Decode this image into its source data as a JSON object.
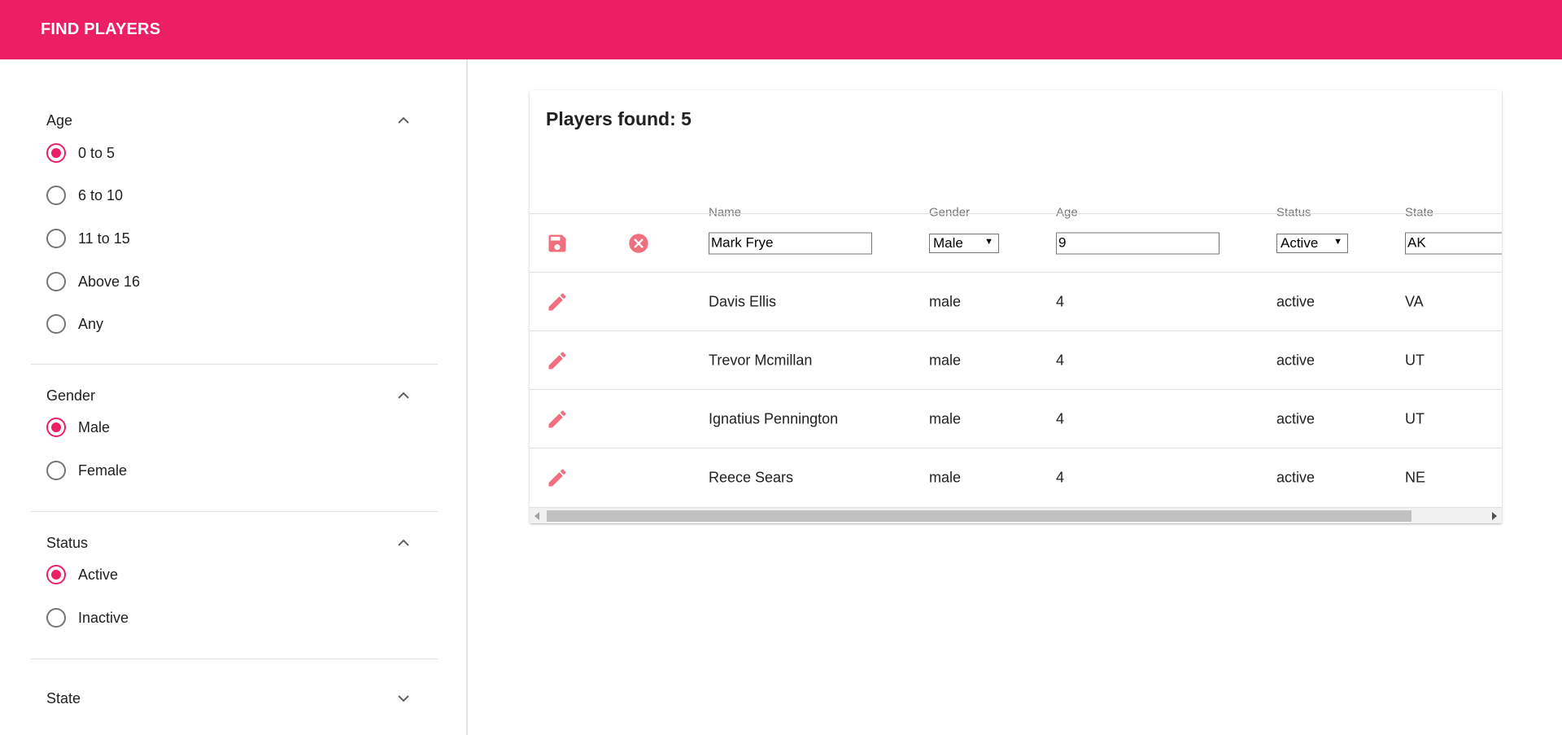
{
  "app": {
    "title": "FIND PLAYERS",
    "accent": "#ec1f65"
  },
  "filters": {
    "age": {
      "label": "Age",
      "expanded": true,
      "options": [
        "0 to 5",
        "6 to 10",
        "11 to 15",
        "Above 16",
        "Any"
      ],
      "selected": "0 to 5"
    },
    "gender": {
      "label": "Gender",
      "expanded": true,
      "options": [
        "Male",
        "Female"
      ],
      "selected": "Male"
    },
    "status": {
      "label": "Status",
      "expanded": true,
      "options": [
        "Active",
        "Inactive"
      ],
      "selected": "Active"
    },
    "state": {
      "label": "State",
      "expanded": false
    }
  },
  "results": {
    "title": "Players found: 5",
    "columns": [
      "Name",
      "Gender",
      "Age",
      "Status",
      "State"
    ],
    "edit_row": {
      "name": "Mark Frye",
      "gender": "Male",
      "age": "9",
      "status": "Active",
      "state": "AK"
    },
    "rows": [
      {
        "name": "Davis Ellis",
        "gender": "male",
        "age": "4",
        "status": "active",
        "state": "VA"
      },
      {
        "name": "Trevor Mcmillan",
        "gender": "male",
        "age": "4",
        "status": "active",
        "state": "UT"
      },
      {
        "name": "Ignatius Pennington",
        "gender": "male",
        "age": "4",
        "status": "active",
        "state": "UT"
      },
      {
        "name": "Reece Sears",
        "gender": "male",
        "age": "4",
        "status": "active",
        "state": "NE"
      }
    ]
  },
  "icons": {
    "save": "save-icon",
    "cancel": "cancel-icon",
    "edit": "pencil-icon",
    "expand": "chevron-up-icon",
    "collapse": "chevron-down-icon"
  }
}
